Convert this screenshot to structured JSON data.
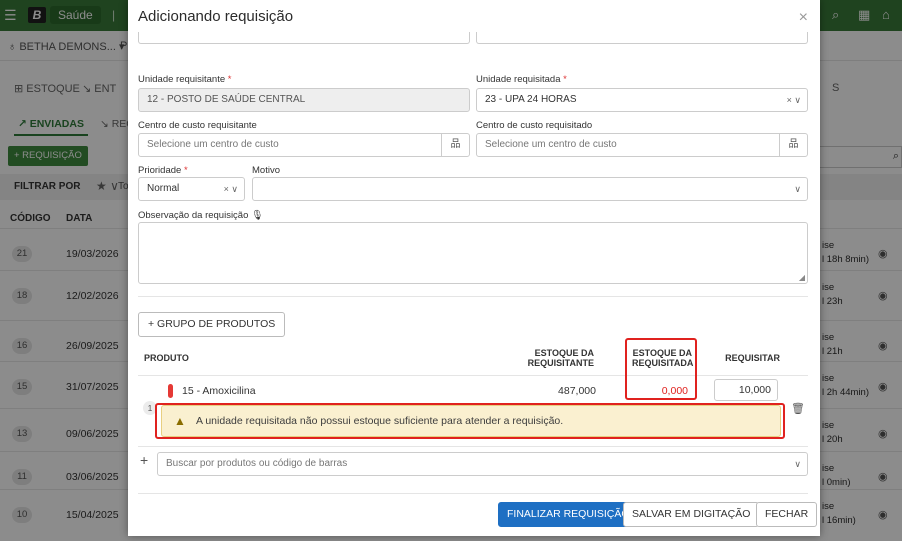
{
  "app": {
    "name": "Saúde",
    "logo_letter": "B",
    "entity": "BETHA DEMONS... ▾",
    "entity_suffix": "P",
    "menu_icon": "hamburger-icon",
    "top_icons": [
      "search-icon",
      "grid-icon",
      "gift-icon"
    ]
  },
  "nav": {
    "tab_estoque": "ESTOQUE",
    "tab_entradas": "ENT",
    "tab_right": "S",
    "sub_tab_active": "ENVIADAS",
    "sub_tab_other": "REC",
    "new_button": "+ REQUISIÇÃO",
    "filter_label": "FILTRAR POR",
    "filter_to": "To"
  },
  "table": {
    "col_code": "CÓDIGO",
    "col_date": "DATA",
    "rows": [
      {
        "code": "21",
        "date": "19/03/2026",
        "status1": "ise",
        "status2": "l 18h 8min)"
      },
      {
        "code": "18",
        "date": "12/02/2026",
        "status1": "ise",
        "status2": "l 23h"
      },
      {
        "code": "16",
        "date": "26/09/2025",
        "status1": "ise",
        "status2": "l 21h"
      },
      {
        "code": "15",
        "date": "31/07/2025",
        "status1": "ise",
        "status2": "l 2h 44min)"
      },
      {
        "code": "13",
        "date": "09/06/2025",
        "status1": "ise",
        "status2": "l 20h"
      },
      {
        "code": "11",
        "date": "03/06/2025",
        "status1": "ise",
        "status2": "l 0min)"
      },
      {
        "code": "10",
        "date": "15/04/2025",
        "status1": "ise",
        "status2": "l 16min)"
      }
    ]
  },
  "modal": {
    "title": "Adicionando requisição",
    "close": "×",
    "unidade_requisitante_label": "Unidade requisitante",
    "unidade_requisitante_value": "12 - POSTO DE SAÚDE CENTRAL",
    "unidade_requisitada_label": "Unidade requisitada",
    "unidade_requisitada_value": "23 - UPA 24 HORAS",
    "centro_req_label": "Centro de custo requisitante",
    "centro_req_placeholder": "Selecione um centro de custo",
    "centro_reqd_label": "Centro de custo requisitado",
    "centro_reqd_placeholder": "Selecione um centro de custo",
    "prioridade_label": "Prioridade",
    "prioridade_value": "Normal",
    "motivo_label": "Motivo",
    "motivo_value": "",
    "observacao_label": "Observação da requisição",
    "required_mark": "*",
    "clear_chevron": "× ∨",
    "chevron": "∨",
    "tree_icon": "品",
    "grupo_button": "+ GRUPO DE PRODUTOS",
    "col_produto": "PRODUTO",
    "col_estoque_requisitante": "ESTOQUE DA REQUISITANTE",
    "col_estoque_requisitada": "ESTOQUE DA REQUISITADA",
    "col_requisitar": "REQUISITAR",
    "product": {
      "name": "15 - Amoxicilina",
      "estoque_requisitante": "487,000",
      "estoque_requisitada": "0,000",
      "requisitar": "10,000",
      "row_index": "1"
    },
    "warning_text": "A unidade requisitada não possui estoque suficiente para atender a requisição.",
    "search_placeholder": "Buscar por produtos ou código de barras",
    "btn_finalizar": "FINALIZAR REQUISIÇÃO",
    "btn_salvar": "SALVAR EM DIGITAÇÃO",
    "btn_fechar": "FECHAR"
  },
  "colors": {
    "brand_green": "#3a7a3a",
    "primary_blue": "#1e6fc3",
    "alert_red": "#e0221f",
    "warning_bg": "#faf0d0"
  }
}
